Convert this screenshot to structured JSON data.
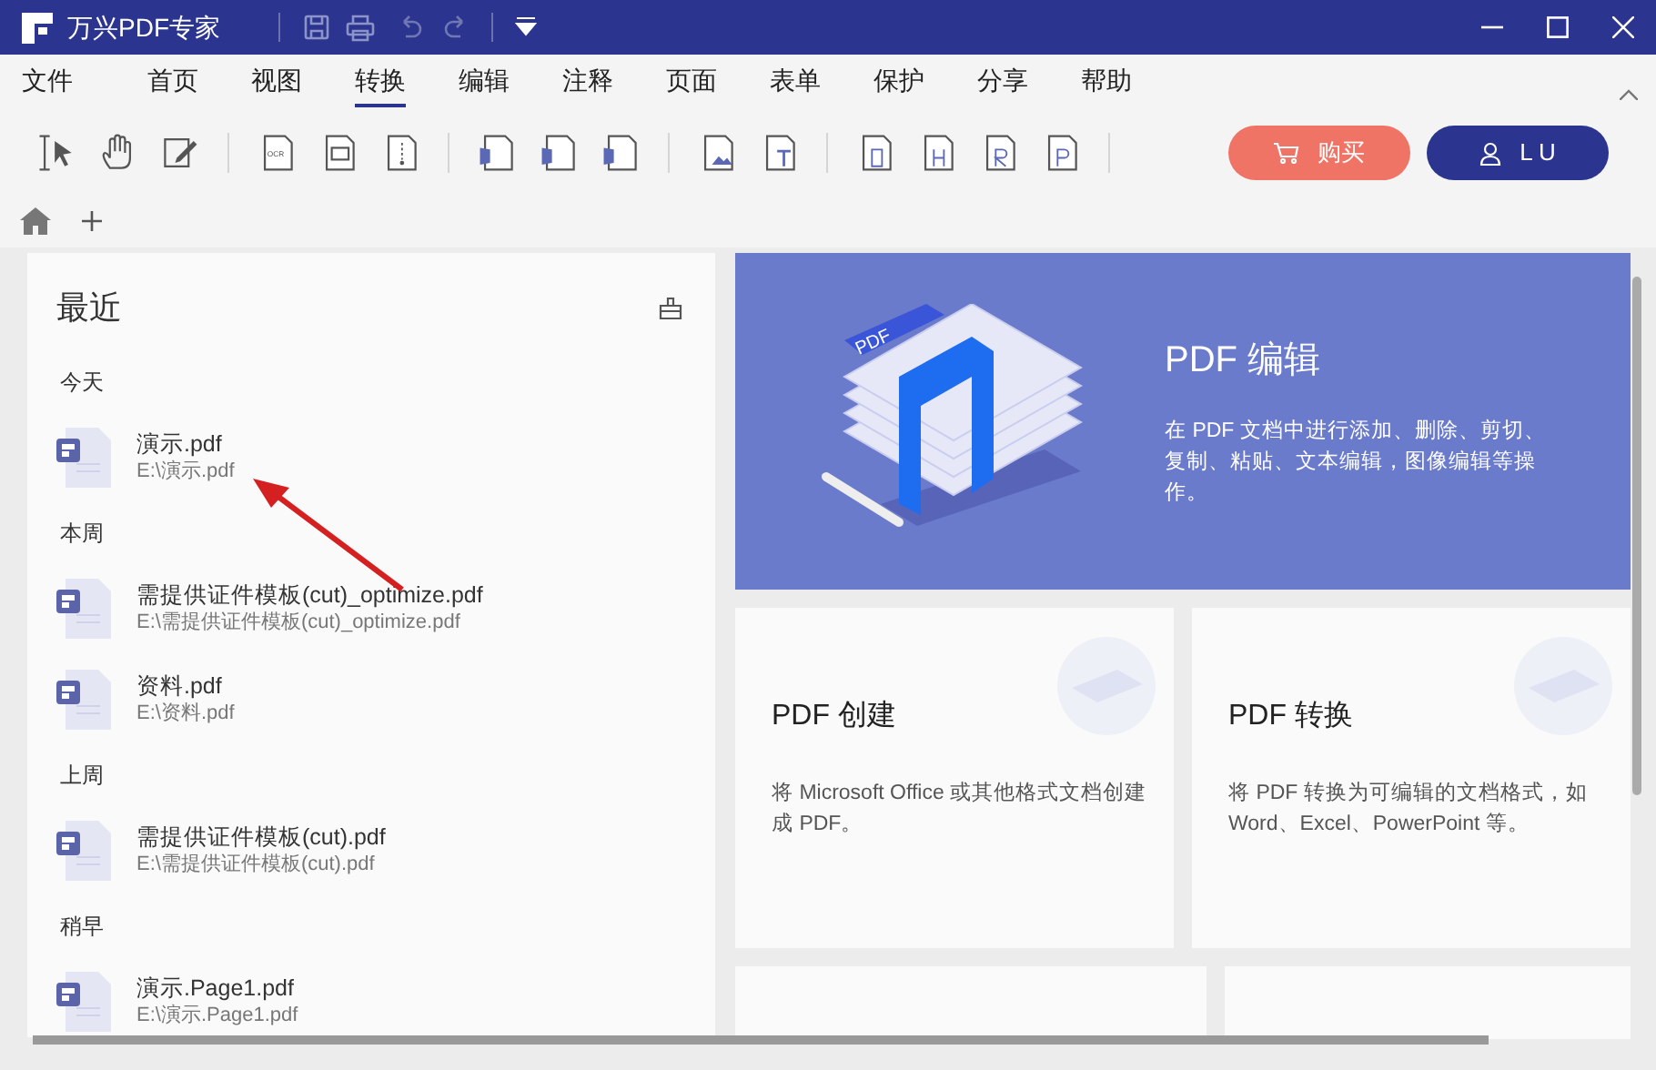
{
  "window": {
    "title": "万兴PDF专家"
  },
  "menu": [
    {
      "label": "文件",
      "selected": false
    },
    {
      "label": "首页",
      "selected": false
    },
    {
      "label": "视图",
      "selected": false
    },
    {
      "label": "转换",
      "selected": true
    },
    {
      "label": "编辑",
      "selected": false
    },
    {
      "label": "注释",
      "selected": false
    },
    {
      "label": "页面",
      "selected": false
    },
    {
      "label": "表单",
      "selected": false
    },
    {
      "label": "保护",
      "selected": false
    },
    {
      "label": "分享",
      "selected": false
    },
    {
      "label": "帮助",
      "selected": false
    }
  ],
  "ocr_icon_label": "OCR",
  "buy_button": {
    "label": "购买"
  },
  "account_button": {
    "label": "L U"
  },
  "recent": {
    "title": "最近",
    "groups": [
      {
        "label": "今天",
        "files": [
          {
            "name": "演示.pdf",
            "path": "E:\\演示.pdf"
          }
        ]
      },
      {
        "label": "本周",
        "files": [
          {
            "name": "需提供证件模板(cut)_optimize.pdf",
            "path": "E:\\需提供证件模板(cut)_optimize.pdf"
          },
          {
            "name": "资料.pdf",
            "path": "E:\\资料.pdf"
          }
        ]
      },
      {
        "label": "上周",
        "files": [
          {
            "name": "需提供证件模板(cut).pdf",
            "path": "E:\\需提供证件模板(cut).pdf"
          }
        ]
      },
      {
        "label": "稍早",
        "files": [
          {
            "name": "演示.Page1.pdf",
            "path": "E:\\演示.Page1.pdf"
          }
        ]
      }
    ]
  },
  "features": [
    {
      "kind": "banner",
      "art_label": "PDF",
      "title": "PDF 编辑",
      "description": "在 PDF 文档中进行添加、删除、剪切、复制、粘贴、文本编辑，图像编辑等操作。"
    },
    {
      "kind": "card",
      "title": "PDF 创建",
      "description": "将 Microsoft Office 或其他格式文档创建成 PDF。"
    },
    {
      "kind": "card",
      "title": "PDF 转换",
      "description": "将 PDF 转换为可编辑的文档格式，如 Word、Excel、PowerPoint 等。"
    }
  ]
}
